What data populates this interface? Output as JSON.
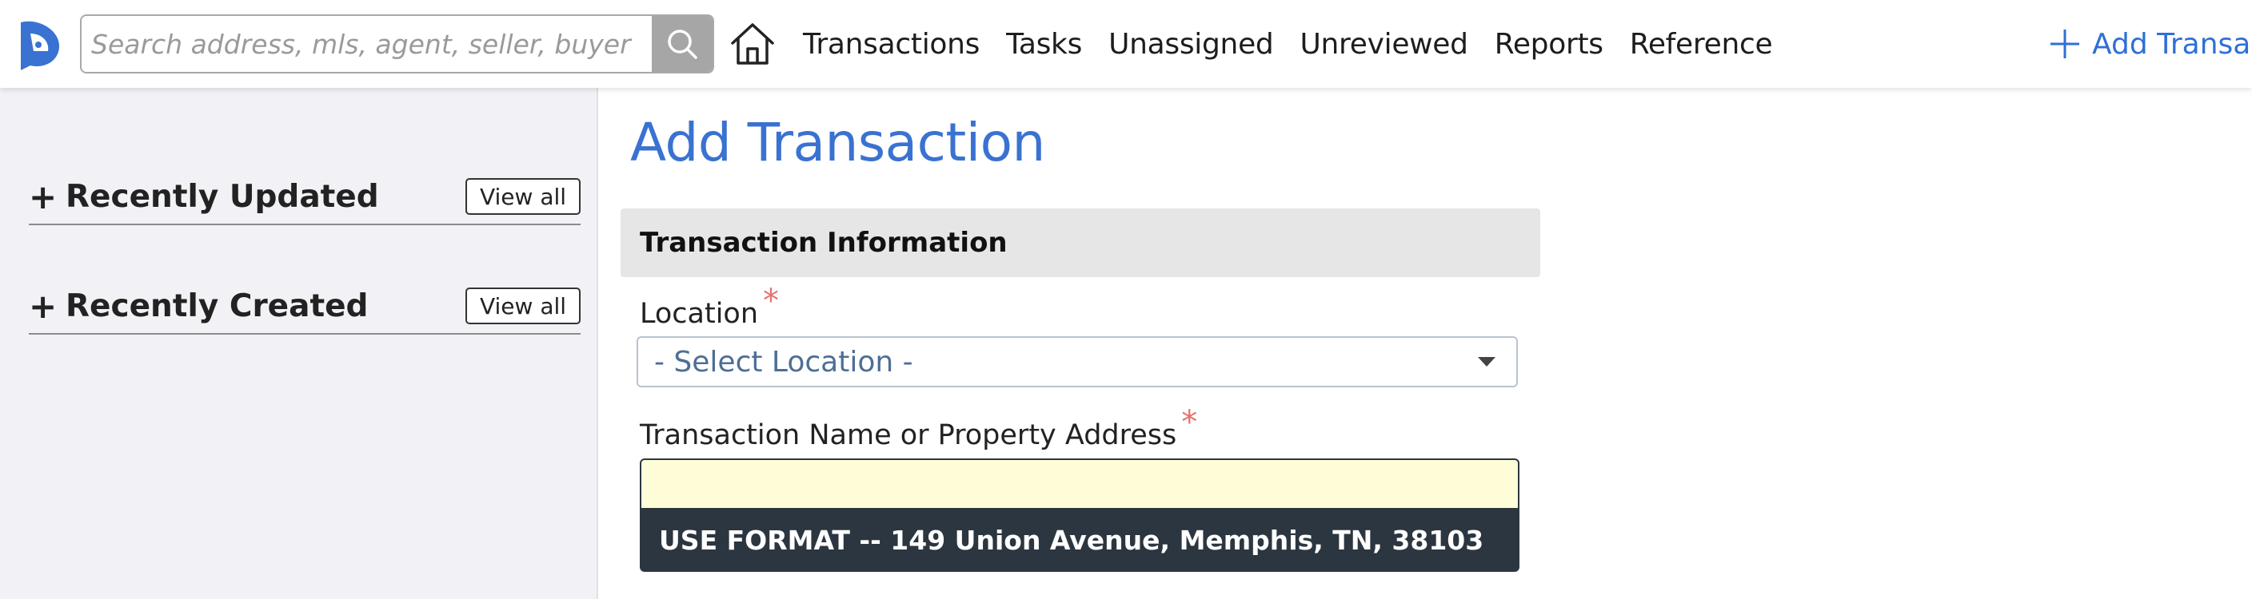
{
  "header": {
    "search": {
      "placeholder": "Search address, mls, agent, seller, buyer",
      "value": ""
    },
    "nav_items": [
      "Transactions",
      "Tasks",
      "Unassigned",
      "Unreviewed",
      "Reports",
      "Reference"
    ],
    "add_transaction_label": "Add Transa",
    "icons": {
      "logo": "brand-logo-icon",
      "search": "search-icon",
      "home": "home-icon",
      "add": "plus-icon"
    }
  },
  "sidebar": {
    "sections": [
      {
        "expander": "+",
        "title": "Recently Updated",
        "action": "View all"
      },
      {
        "expander": "+",
        "title": "Recently Created",
        "action": "View all"
      }
    ]
  },
  "main": {
    "title": "Add Transaction",
    "section_title": "Transaction Information",
    "location": {
      "label": "Location",
      "required_marker": "*",
      "selected": "- Select Location -"
    },
    "name_field": {
      "label": "Transaction Name or Property Address",
      "required_marker": "*",
      "value": "",
      "hint": "USE FORMAT -- 149 Union Avenue, Memphis, TN, 38103"
    }
  },
  "colors": {
    "accent": "#3a72d1",
    "required": "#e8706e",
    "hint_bg": "#2c3640",
    "input_highlight": "#fefdd8",
    "sidebar_bg": "#f2f1f5"
  }
}
